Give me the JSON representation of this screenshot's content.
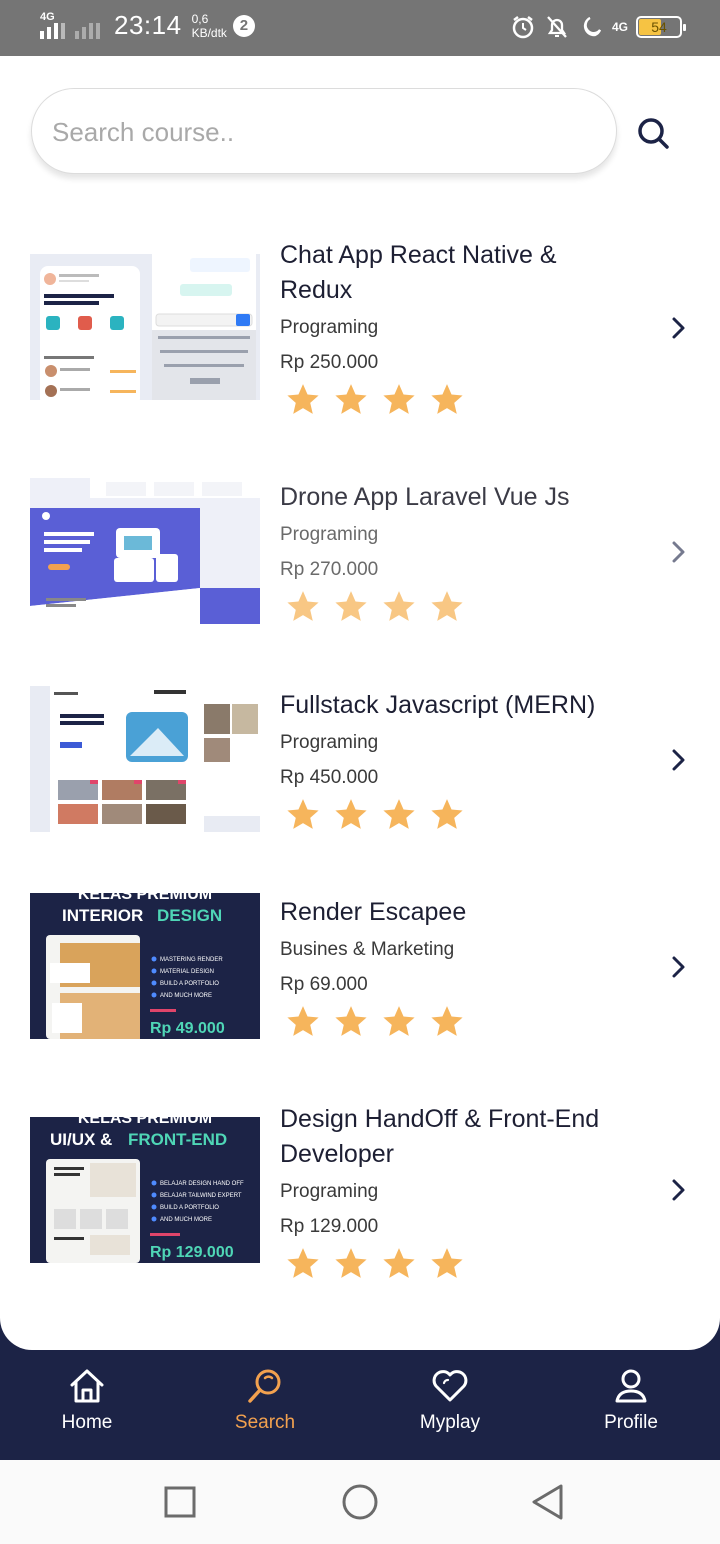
{
  "status_bar": {
    "network_left": "4G",
    "time": "23:14",
    "speed_value": "0,6",
    "speed_unit": "KB/dtk",
    "badge": "2",
    "network_right": "4G",
    "battery": "54",
    "battery_level": 0.54
  },
  "search": {
    "placeholder": "Search course.."
  },
  "courses": [
    {
      "title": "Chat App React Native &\n Redux",
      "category": "Programing",
      "price": "Rp 250.000",
      "rating": 4,
      "thumb_text": []
    },
    {
      "title": "Drone App Laravel Vue Js",
      "category": "Programing",
      "price": "Rp 270.000",
      "rating": 4,
      "thumb_text": []
    },
    {
      "title": "Fullstack Javascript (MERN)",
      "category": "Programing",
      "price": "Rp 450.000",
      "rating": 4,
      "thumb_text": []
    },
    {
      "title": "Render Escapee",
      "category": "Busines & Marketing",
      "price": "Rp 69.000",
      "rating": 4,
      "thumb_text": [
        "KELAS PREMIUM",
        "INTERIOR",
        "DESIGN",
        "MASTERING RENDER",
        "MATERIAL DESIGN",
        "BUILD A PORTFOLIO",
        "AND MUCH MORE",
        "Rp 49.000"
      ]
    },
    {
      "title": "Design HandOff & Front-End Developer",
      "category": "Programing",
      "price": "Rp 129.000",
      "rating": 4,
      "thumb_text": [
        "KELAS PREMIUM",
        "UI/UX &",
        "FRONT-END",
        "BELAJAR DESIGN HAND OFF",
        "BELAJAR TAILWIND EXPERT",
        "BUILD A PORTFOLIO",
        "AND MUCH MORE",
        "Rp 129.000"
      ]
    }
  ],
  "nav": {
    "home": "Home",
    "search": "Search",
    "myplay": "Myplay",
    "profile": "Profile"
  },
  "colors": {
    "nav_bg": "#1c2346",
    "accent": "#f2a14f",
    "star": "#f6b55c"
  },
  "icons": [
    "search-icon",
    "chevron-right-icon",
    "star-icon",
    "home-icon",
    "heart-icon",
    "profile-icon",
    "square-icon",
    "circle-icon",
    "back-triangle-icon"
  ]
}
